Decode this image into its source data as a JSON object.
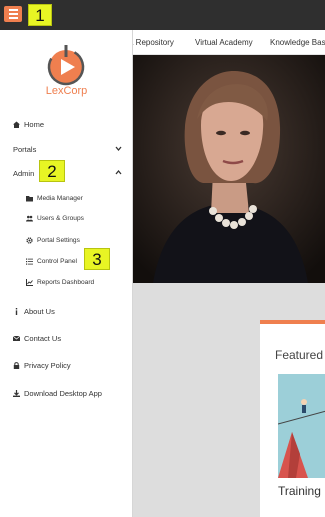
{
  "topbar": {
    "menu_icon": "hamburger-menu-icon",
    "accent": "#ef7f4f",
    "bg": "#2f2f2f"
  },
  "annotations": [
    "1",
    "2",
    "3"
  ],
  "nav": [
    "a Repository",
    "Virtual Academy",
    "Knowledge Base"
  ],
  "sidebar": {
    "brand": "LexCorp",
    "items": [
      {
        "label": "Home",
        "icon": "home-icon"
      },
      {
        "label": "Portals",
        "icon": "",
        "chevron": "chevron-down-icon"
      },
      {
        "label": "Admin",
        "icon": "",
        "chevron": "chevron-up-icon"
      },
      {
        "label": "Media Manager",
        "icon": "folder-icon"
      },
      {
        "label": "Users & Groups",
        "icon": "users-icon"
      },
      {
        "label": "Portal Settings",
        "icon": "gear-icon"
      },
      {
        "label": "Control Panel",
        "icon": "list-icon"
      },
      {
        "label": "Reports Dashboard",
        "icon": "chart-icon"
      },
      {
        "label": "About Us",
        "icon": "info-icon"
      },
      {
        "label": "Contact Us",
        "icon": "envelope-icon"
      },
      {
        "label": "Privacy Policy",
        "icon": "lock-icon"
      },
      {
        "label": "Download Desktop App",
        "icon": "download-icon"
      }
    ]
  },
  "featured": {
    "title": "Featured",
    "caption": "Training"
  }
}
